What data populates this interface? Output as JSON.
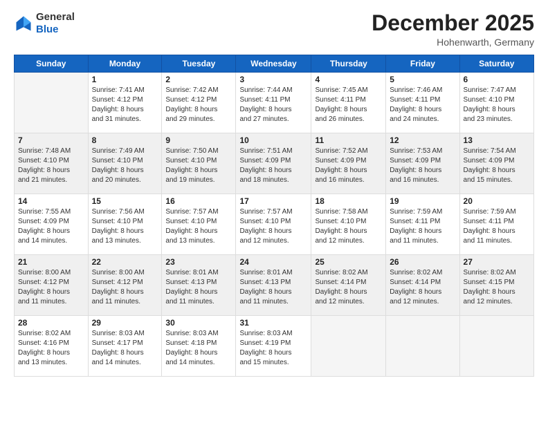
{
  "header": {
    "logo_line1": "General",
    "logo_line2": "Blue",
    "month": "December 2025",
    "location": "Hohenwarth, Germany"
  },
  "days_of_week": [
    "Sunday",
    "Monday",
    "Tuesday",
    "Wednesday",
    "Thursday",
    "Friday",
    "Saturday"
  ],
  "weeks": [
    [
      {
        "day": "",
        "sunrise": "",
        "sunset": "",
        "daylight": ""
      },
      {
        "day": "1",
        "sunrise": "Sunrise: 7:41 AM",
        "sunset": "Sunset: 4:12 PM",
        "daylight": "Daylight: 8 hours and 31 minutes."
      },
      {
        "day": "2",
        "sunrise": "Sunrise: 7:42 AM",
        "sunset": "Sunset: 4:12 PM",
        "daylight": "Daylight: 8 hours and 29 minutes."
      },
      {
        "day": "3",
        "sunrise": "Sunrise: 7:44 AM",
        "sunset": "Sunset: 4:11 PM",
        "daylight": "Daylight: 8 hours and 27 minutes."
      },
      {
        "day": "4",
        "sunrise": "Sunrise: 7:45 AM",
        "sunset": "Sunset: 4:11 PM",
        "daylight": "Daylight: 8 hours and 26 minutes."
      },
      {
        "day": "5",
        "sunrise": "Sunrise: 7:46 AM",
        "sunset": "Sunset: 4:11 PM",
        "daylight": "Daylight: 8 hours and 24 minutes."
      },
      {
        "day": "6",
        "sunrise": "Sunrise: 7:47 AM",
        "sunset": "Sunset: 4:10 PM",
        "daylight": "Daylight: 8 hours and 23 minutes."
      }
    ],
    [
      {
        "day": "7",
        "sunrise": "Sunrise: 7:48 AM",
        "sunset": "Sunset: 4:10 PM",
        "daylight": "Daylight: 8 hours and 21 minutes."
      },
      {
        "day": "8",
        "sunrise": "Sunrise: 7:49 AM",
        "sunset": "Sunset: 4:10 PM",
        "daylight": "Daylight: 8 hours and 20 minutes."
      },
      {
        "day": "9",
        "sunrise": "Sunrise: 7:50 AM",
        "sunset": "Sunset: 4:10 PM",
        "daylight": "Daylight: 8 hours and 19 minutes."
      },
      {
        "day": "10",
        "sunrise": "Sunrise: 7:51 AM",
        "sunset": "Sunset: 4:09 PM",
        "daylight": "Daylight: 8 hours and 18 minutes."
      },
      {
        "day": "11",
        "sunrise": "Sunrise: 7:52 AM",
        "sunset": "Sunset: 4:09 PM",
        "daylight": "Daylight: 8 hours and 16 minutes."
      },
      {
        "day": "12",
        "sunrise": "Sunrise: 7:53 AM",
        "sunset": "Sunset: 4:09 PM",
        "daylight": "Daylight: 8 hours and 16 minutes."
      },
      {
        "day": "13",
        "sunrise": "Sunrise: 7:54 AM",
        "sunset": "Sunset: 4:09 PM",
        "daylight": "Daylight: 8 hours and 15 minutes."
      }
    ],
    [
      {
        "day": "14",
        "sunrise": "Sunrise: 7:55 AM",
        "sunset": "Sunset: 4:09 PM",
        "daylight": "Daylight: 8 hours and 14 minutes."
      },
      {
        "day": "15",
        "sunrise": "Sunrise: 7:56 AM",
        "sunset": "Sunset: 4:10 PM",
        "daylight": "Daylight: 8 hours and 13 minutes."
      },
      {
        "day": "16",
        "sunrise": "Sunrise: 7:57 AM",
        "sunset": "Sunset: 4:10 PM",
        "daylight": "Daylight: 8 hours and 13 minutes."
      },
      {
        "day": "17",
        "sunrise": "Sunrise: 7:57 AM",
        "sunset": "Sunset: 4:10 PM",
        "daylight": "Daylight: 8 hours and 12 minutes."
      },
      {
        "day": "18",
        "sunrise": "Sunrise: 7:58 AM",
        "sunset": "Sunset: 4:10 PM",
        "daylight": "Daylight: 8 hours and 12 minutes."
      },
      {
        "day": "19",
        "sunrise": "Sunrise: 7:59 AM",
        "sunset": "Sunset: 4:11 PM",
        "daylight": "Daylight: 8 hours and 11 minutes."
      },
      {
        "day": "20",
        "sunrise": "Sunrise: 7:59 AM",
        "sunset": "Sunset: 4:11 PM",
        "daylight": "Daylight: 8 hours and 11 minutes."
      }
    ],
    [
      {
        "day": "21",
        "sunrise": "Sunrise: 8:00 AM",
        "sunset": "Sunset: 4:12 PM",
        "daylight": "Daylight: 8 hours and 11 minutes."
      },
      {
        "day": "22",
        "sunrise": "Sunrise: 8:00 AM",
        "sunset": "Sunset: 4:12 PM",
        "daylight": "Daylight: 8 hours and 11 minutes."
      },
      {
        "day": "23",
        "sunrise": "Sunrise: 8:01 AM",
        "sunset": "Sunset: 4:13 PM",
        "daylight": "Daylight: 8 hours and 11 minutes."
      },
      {
        "day": "24",
        "sunrise": "Sunrise: 8:01 AM",
        "sunset": "Sunset: 4:13 PM",
        "daylight": "Daylight: 8 hours and 11 minutes."
      },
      {
        "day": "25",
        "sunrise": "Sunrise: 8:02 AM",
        "sunset": "Sunset: 4:14 PM",
        "daylight": "Daylight: 8 hours and 12 minutes."
      },
      {
        "day": "26",
        "sunrise": "Sunrise: 8:02 AM",
        "sunset": "Sunset: 4:14 PM",
        "daylight": "Daylight: 8 hours and 12 minutes."
      },
      {
        "day": "27",
        "sunrise": "Sunrise: 8:02 AM",
        "sunset": "Sunset: 4:15 PM",
        "daylight": "Daylight: 8 hours and 12 minutes."
      }
    ],
    [
      {
        "day": "28",
        "sunrise": "Sunrise: 8:02 AM",
        "sunset": "Sunset: 4:16 PM",
        "daylight": "Daylight: 8 hours and 13 minutes."
      },
      {
        "day": "29",
        "sunrise": "Sunrise: 8:03 AM",
        "sunset": "Sunset: 4:17 PM",
        "daylight": "Daylight: 8 hours and 14 minutes."
      },
      {
        "day": "30",
        "sunrise": "Sunrise: 8:03 AM",
        "sunset": "Sunset: 4:18 PM",
        "daylight": "Daylight: 8 hours and 14 minutes."
      },
      {
        "day": "31",
        "sunrise": "Sunrise: 8:03 AM",
        "sunset": "Sunset: 4:19 PM",
        "daylight": "Daylight: 8 hours and 15 minutes."
      },
      {
        "day": "",
        "sunrise": "",
        "sunset": "",
        "daylight": ""
      },
      {
        "day": "",
        "sunrise": "",
        "sunset": "",
        "daylight": ""
      },
      {
        "day": "",
        "sunrise": "",
        "sunset": "",
        "daylight": ""
      }
    ]
  ]
}
